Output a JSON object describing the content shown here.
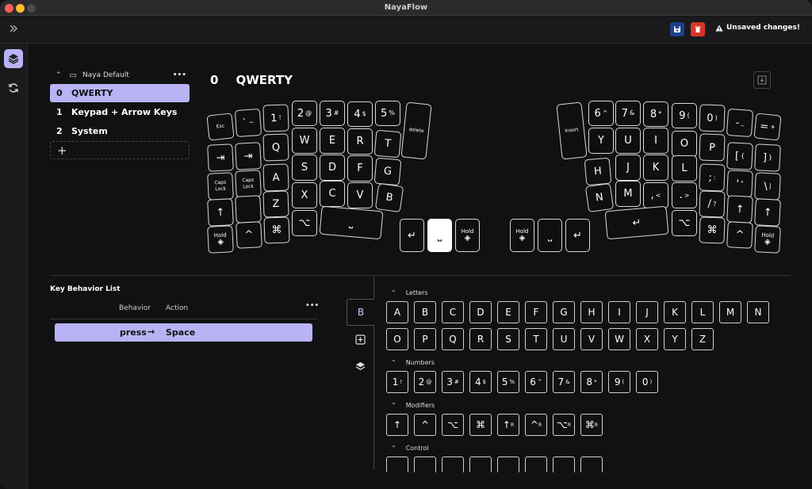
{
  "app": {
    "title": "NayaFlow"
  },
  "colors": {
    "accent": "#b8b3f4",
    "save": "#1e3f8a",
    "delete": "#d8352a",
    "close": "#ff5f57",
    "minimize": "#febc2e",
    "zoom": "#3a3a3c"
  },
  "toolbar": {
    "unsaved": "Unsaved changes!",
    "expand_icon": "double-chevron-right-icon"
  },
  "sidebar": {
    "items": [
      {
        "icon": "layers-icon"
      },
      {
        "icon": "sync-icon"
      }
    ]
  },
  "layers": {
    "group": "Naya Default",
    "more": "•••",
    "items": [
      {
        "num": "0",
        "label": "QWERTY",
        "selected": true
      },
      {
        "num": "1",
        "label": "Keypad + Arrow Keys"
      },
      {
        "num": "2",
        "label": "System"
      }
    ],
    "add": "+"
  },
  "layer_title": {
    "num": "0",
    "name": "QWERTY"
  },
  "keyboard": {
    "left": [
      {
        "l": "Esc",
        "s": 1
      },
      {
        "l": "`~"
      },
      {
        "l": "1!"
      },
      {
        "l": "2@"
      },
      {
        "l": "3#"
      },
      {
        "l": "4$"
      },
      {
        "l": "5%"
      },
      {
        "l": "delete",
        "s": 1
      },
      {
        "l": "⇥"
      },
      {
        "l": "⇥"
      },
      {
        "l": "Q"
      },
      {
        "l": "W"
      },
      {
        "l": "E"
      },
      {
        "l": "R"
      },
      {
        "l": "T"
      },
      {
        "l": "Caps Lock",
        "s": 1
      },
      {
        "l": "Caps Lock",
        "s": 1
      },
      {
        "l": "A"
      },
      {
        "l": "S"
      },
      {
        "l": "D"
      },
      {
        "l": "F"
      },
      {
        "l": "G"
      },
      {
        "l": "↑"
      },
      {
        "l": ""
      },
      {
        "l": "Z"
      },
      {
        "l": "X"
      },
      {
        "l": "C"
      },
      {
        "l": "V"
      },
      {
        "l": "B"
      },
      {
        "l": "Hold"
      },
      {
        "l": "^"
      },
      {
        "l": "⌘"
      },
      {
        "l": "⌥"
      },
      {
        "l": "⎵"
      },
      {
        "l": "↵"
      },
      {
        "l": "⎵"
      },
      {
        "l": "Hold"
      }
    ],
    "right": [
      {
        "l": "Insert",
        "s": 1
      },
      {
        "l": "6^"
      },
      {
        "l": "7&"
      },
      {
        "l": "8*"
      },
      {
        "l": "9("
      },
      {
        "l": "0)"
      },
      {
        "l": "-_"
      },
      {
        "l": "=+"
      },
      {
        "l": "Y"
      },
      {
        "l": "U"
      },
      {
        "l": "I"
      },
      {
        "l": "O"
      },
      {
        "l": "P"
      },
      {
        "l": "[{"
      },
      {
        "l": "]}"
      },
      {
        "l": "H"
      },
      {
        "l": "J"
      },
      {
        "l": "K"
      },
      {
        "l": "L"
      },
      {
        "l": ";:"
      },
      {
        "l": "'\""
      },
      {
        "l": "\\|"
      },
      {
        "l": "N"
      },
      {
        "l": "M"
      },
      {
        "l": ",<"
      },
      {
        "l": ".>"
      },
      {
        "l": "/?"
      },
      {
        "l": "↑"
      },
      {
        "l": "↑"
      },
      {
        "l": "↵"
      },
      {
        "l": "⌥"
      },
      {
        "l": "⌘"
      },
      {
        "l": "^"
      },
      {
        "l": "Hold"
      },
      {
        "l": "Hold"
      },
      {
        "l": "⎵"
      },
      {
        "l": "↵"
      }
    ]
  },
  "behavior": {
    "title": "Key Behavior List",
    "col_behavior": "Behavior",
    "col_action": "Action",
    "more": "•••",
    "row": {
      "behavior": "press",
      "arrow": "→",
      "action": "Space"
    }
  },
  "tabs": [
    {
      "label": "B",
      "selected": true
    },
    {
      "icon": "plus-square-icon"
    },
    {
      "icon": "layers-icon"
    }
  ],
  "palette": {
    "sections": [
      {
        "title": "Letters",
        "rows": [
          [
            "A",
            "B",
            "C",
            "D",
            "E",
            "F",
            "G",
            "H",
            "I",
            "J",
            "K",
            "L",
            "M",
            "N"
          ],
          [
            "O",
            "P",
            "Q",
            "R",
            "S",
            "T",
            "U",
            "V",
            "W",
            "X",
            "Y",
            "Z"
          ]
        ]
      },
      {
        "title": "Numbers",
        "rows": [
          [
            "1!",
            "2@",
            "3#",
            "4$",
            "5%",
            "6^",
            "7&",
            "8*",
            "9(",
            "0)"
          ]
        ]
      },
      {
        "title": "Modifiers",
        "rows": [
          [
            "↑",
            "^",
            "⌥",
            "⌘",
            "↑R",
            "^R",
            "⌥R",
            "⌘R"
          ]
        ]
      },
      {
        "title": "Control",
        "rows": [
          [
            "",
            "",
            "",
            "",
            "",
            "",
            "",
            ""
          ]
        ]
      }
    ]
  }
}
